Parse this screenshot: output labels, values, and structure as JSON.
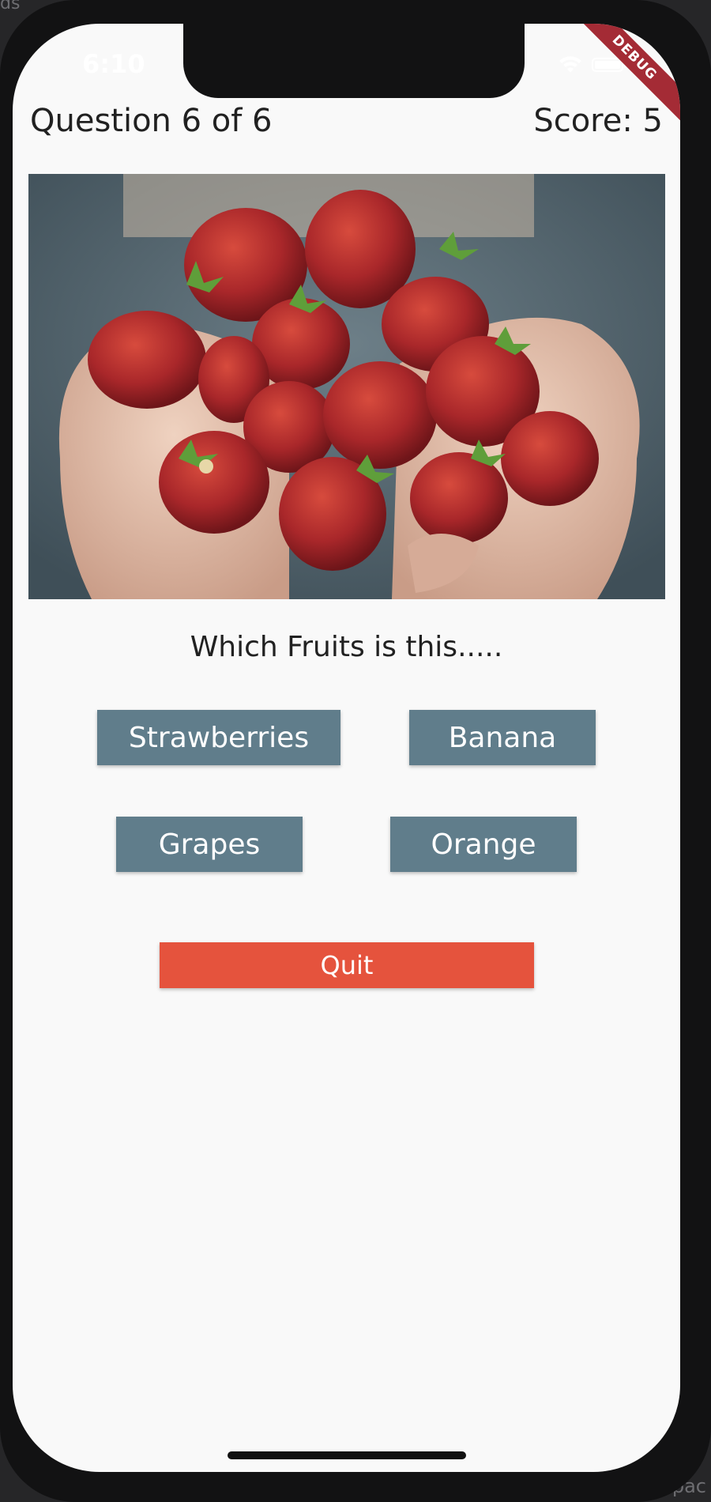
{
  "background": {
    "top_left_text": "ds",
    "bottom_right_text": "spac"
  },
  "status_bar": {
    "time": "6:10",
    "icons": [
      "wifi-icon",
      "battery-icon"
    ]
  },
  "debug_banner": {
    "label": "DEBUG",
    "color": "#a42b35"
  },
  "header": {
    "question_counter": "Question 6 of 6",
    "score": "Score: 5"
  },
  "image": {
    "subject": "hands holding strawberries"
  },
  "quiz": {
    "question": "Which Fruits is this.....",
    "options": [
      "Strawberries",
      "Banana",
      "Grapes",
      "Orange"
    ],
    "option_color": "#607d8b",
    "quit_label": "Quit",
    "quit_color": "#e5533d"
  }
}
